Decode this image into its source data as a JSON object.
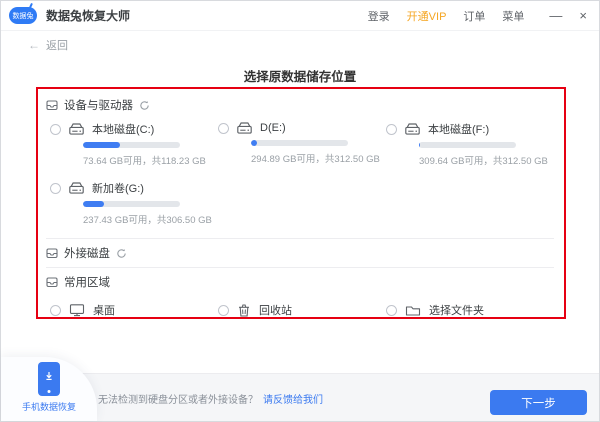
{
  "colors": {
    "accent": "#3b7af0",
    "vip_orange": "#f5a623",
    "highlight_red": "#e60012",
    "bar_fill": "#3f7df2"
  },
  "titlebar": {
    "logo_text": "数据兔",
    "app_title": "数据兔恢复大师",
    "nav": {
      "login": "登录",
      "vip": "开通VIP",
      "orders": "订单",
      "menu": "菜单"
    },
    "window": {
      "minimize": "—",
      "close": "×"
    }
  },
  "nav_back": {
    "arrow": "←",
    "label": "返回"
  },
  "page": {
    "title": "选择原数据储存位置"
  },
  "box": {
    "devices": {
      "title": "设备与驱动器",
      "drives": [
        {
          "name": "本地磁盘(C:)",
          "info": "73.64 GB可用，共118.23 GB",
          "used_percent": 38
        },
        {
          "name": "D(E:)",
          "info": "294.89 GB可用，共312.50 GB",
          "used_percent": 6
        },
        {
          "name": "本地磁盘(F:)",
          "info": "309.64 GB可用，共312.50 GB",
          "used_percent": 1
        },
        {
          "name": "新加卷(G:)",
          "info": "237.43 GB可用，共306.50 GB",
          "used_percent": 22
        }
      ]
    },
    "external": {
      "title": "外接磁盘"
    },
    "common": {
      "title": "常用区域",
      "items": [
        {
          "label": "桌面"
        },
        {
          "label": "回收站"
        },
        {
          "label": "选择文件夹"
        }
      ]
    }
  },
  "footer": {
    "phone_panel_label": "手机数据恢复",
    "hint_text": "无法检测到硬盘分区或者外接设备？",
    "hint_link": "请反馈给我们",
    "next_button": "下一步"
  }
}
